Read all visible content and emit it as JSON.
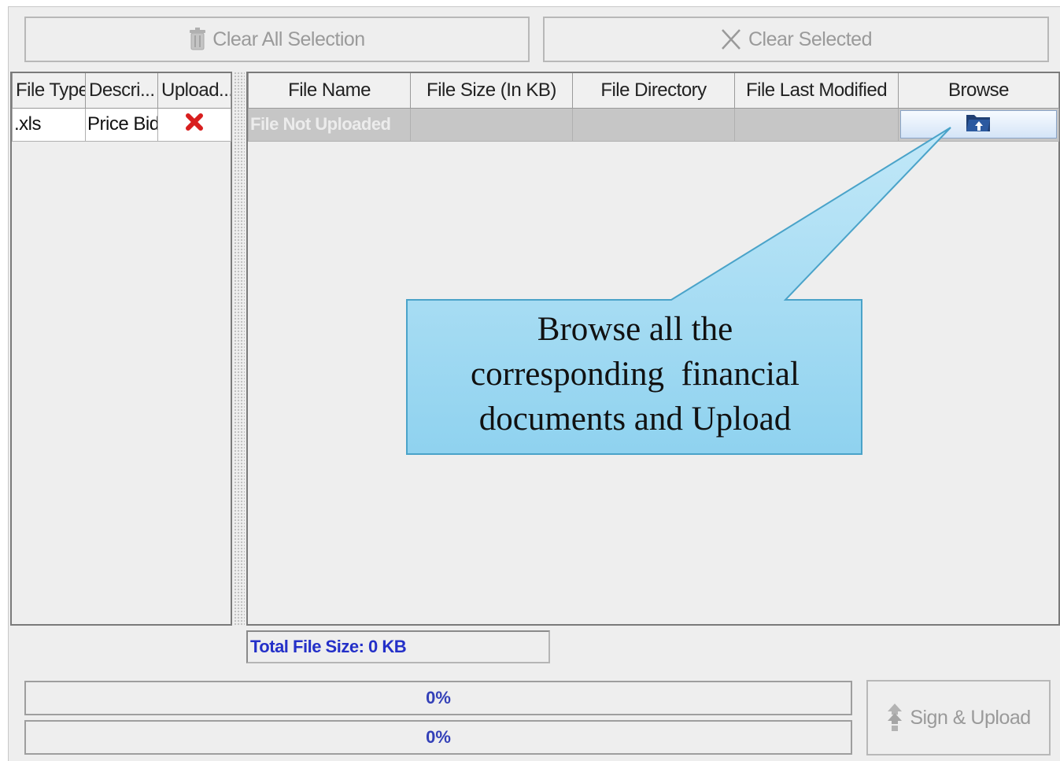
{
  "toolbar": {
    "clear_all_label": "Clear All Selection",
    "clear_selected_label": "Clear Selected"
  },
  "left_table": {
    "headers": [
      "File Type",
      "Descri...",
      "Upload..."
    ],
    "rows": [
      {
        "file_type": ".xls",
        "description": "Price Bid",
        "uploaded_icon": "red-x-icon"
      }
    ]
  },
  "right_table": {
    "headers": [
      "File Name",
      "File Size (In KB)",
      "File Directory",
      "File Last Modified",
      "Browse"
    ],
    "rows": [
      {
        "file_name": "File Not Uploaded",
        "file_size": "",
        "file_directory": "",
        "file_last_modified": "",
        "browse_icon": "folder-upload-icon"
      }
    ]
  },
  "total_file_size": "Total File Size: 0 KB",
  "progress": [
    {
      "label": "0%",
      "value": 0
    },
    {
      "label": "0%",
      "value": 0
    }
  ],
  "sign_upload_label": "Sign & Upload",
  "callout": {
    "lines": [
      "Browse all the",
      "corresponding  financial",
      "documents and Upload"
    ],
    "fill": "#a9dcf3",
    "border": "#4aa3c9"
  },
  "colors": {
    "background": "#eeeeee",
    "total_text": "#2430c8",
    "error_icon": "#d81e1e"
  }
}
